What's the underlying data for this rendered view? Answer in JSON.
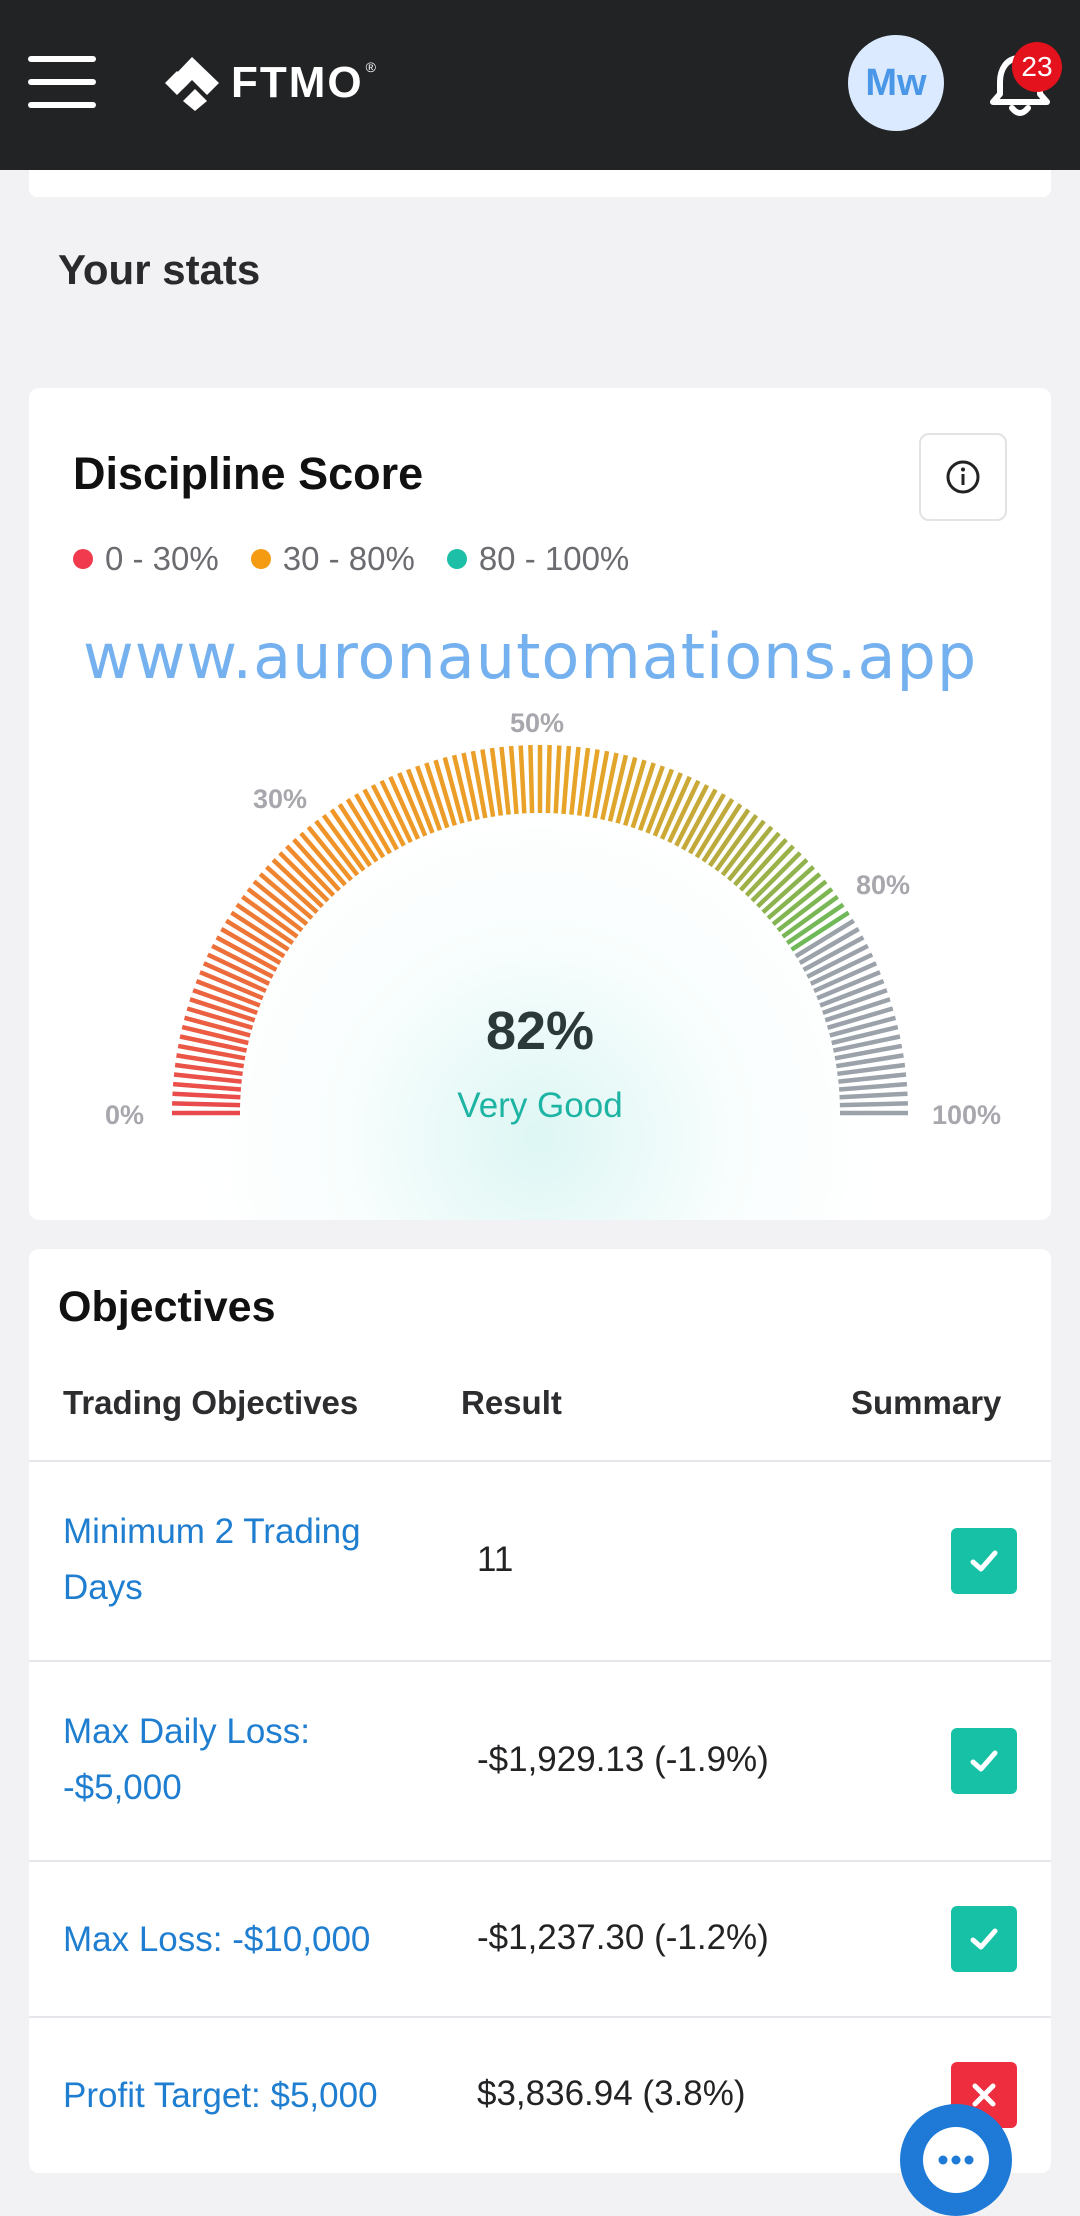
{
  "header": {
    "brand": "FTMO",
    "avatar_initials": "Mw",
    "notification_count": "23"
  },
  "stats": {
    "title": "Your stats"
  },
  "discipline": {
    "title": "Discipline Score",
    "legend": [
      {
        "label": "0 - 30%",
        "color": "#f23a4e"
      },
      {
        "label": "30 - 80%",
        "color": "#f59b12"
      },
      {
        "label": "80 - 100%",
        "color": "#1dbfa7"
      }
    ],
    "watermark": "www.auronautomations.app",
    "gauge": {
      "value": 82,
      "value_label": "82%",
      "status": "Very Good",
      "tick_labels": {
        "p0": "0%",
        "p30": "30%",
        "p50": "50%",
        "p80": "80%",
        "p100": "100%"
      }
    }
  },
  "objectives": {
    "title": "Objectives",
    "columns": {
      "objective": "Trading Objectives",
      "result": "Result",
      "summary": "Summary"
    },
    "rows": [
      {
        "objective": "Minimum 2 Trading Days",
        "result": "11",
        "passed": true
      },
      {
        "objective": "Max Daily Loss: -$5,000",
        "result": "-$1,929.13 (-1.9%)",
        "passed": true
      },
      {
        "objective": "Max Loss: -$10,000",
        "result": "-$1,237.30 (-1.2%)",
        "passed": true
      },
      {
        "objective": "Profit Target: $5,000",
        "result": "$3,836.94 (3.8%)",
        "passed": false
      }
    ],
    "pass_color": "#17c1a6",
    "fail_color": "#ee2d3f"
  }
}
